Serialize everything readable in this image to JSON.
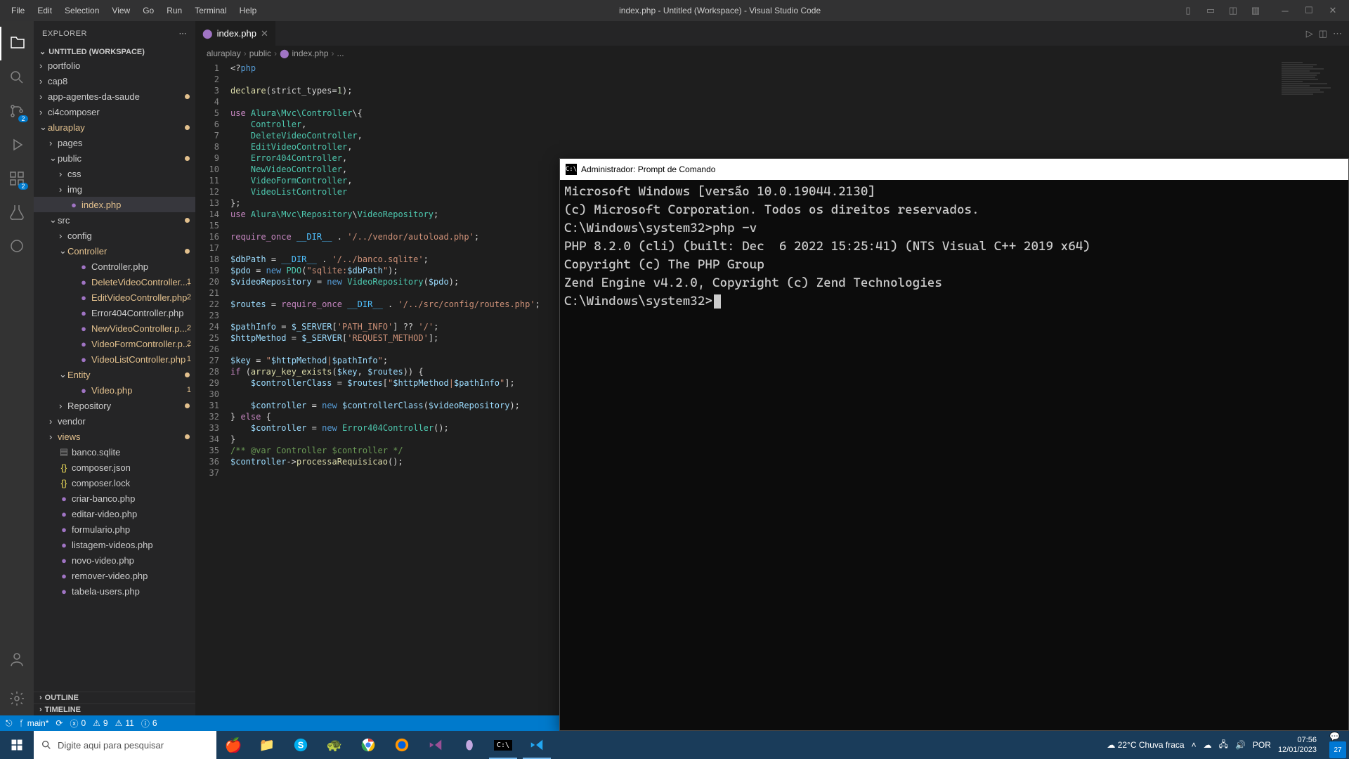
{
  "titlebar": {
    "menus": [
      "File",
      "Edit",
      "Selection",
      "View",
      "Go",
      "Run",
      "Terminal",
      "Help"
    ],
    "title": "index.php - Untitled (Workspace) - Visual Studio Code"
  },
  "activitybar": {
    "scm_badge": "2",
    "ext_badge": "2"
  },
  "sidebar": {
    "header": "EXPLORER",
    "workspace": "UNTITLED (WORKSPACE)",
    "outline": "OUTLINE",
    "timeline": "TIMELINE",
    "tree": [
      {
        "depth": 0,
        "type": "folder",
        "open": false,
        "label": "portfolio"
      },
      {
        "depth": 0,
        "type": "folder",
        "open": false,
        "label": "cap8"
      },
      {
        "depth": 0,
        "type": "folder",
        "open": false,
        "label": "app-agentes-da-saude",
        "dot": true
      },
      {
        "depth": 0,
        "type": "folder",
        "open": false,
        "label": "ci4composer"
      },
      {
        "depth": 0,
        "type": "folder",
        "open": true,
        "label": "aluraplay",
        "mod": true,
        "dot": true
      },
      {
        "depth": 1,
        "type": "folder",
        "open": false,
        "label": "pages"
      },
      {
        "depth": 1,
        "type": "folder",
        "open": true,
        "label": "public",
        "dot": true
      },
      {
        "depth": 2,
        "type": "folder",
        "open": false,
        "label": "css"
      },
      {
        "depth": 2,
        "type": "folder",
        "open": false,
        "label": "img"
      },
      {
        "depth": 2,
        "type": "file",
        "icon": "php",
        "label": "index.php",
        "selected": true,
        "mod": true
      },
      {
        "depth": 1,
        "type": "folder",
        "open": true,
        "label": "src",
        "dot": true
      },
      {
        "depth": 2,
        "type": "folder",
        "open": false,
        "label": "config"
      },
      {
        "depth": 2,
        "type": "folder",
        "open": true,
        "label": "Controller",
        "mod": true,
        "dot": true
      },
      {
        "depth": 3,
        "type": "file",
        "icon": "php",
        "label": "Controller.php"
      },
      {
        "depth": 3,
        "type": "file",
        "icon": "php",
        "label": "DeleteVideoController....",
        "mod": true,
        "badge": "1"
      },
      {
        "depth": 3,
        "type": "file",
        "icon": "php",
        "label": "EditVideoController.php",
        "mod": true,
        "badge": "2"
      },
      {
        "depth": 3,
        "type": "file",
        "icon": "php",
        "label": "Error404Controller.php"
      },
      {
        "depth": 3,
        "type": "file",
        "icon": "php",
        "label": "NewVideoController.p...",
        "mod": true,
        "badge": "2"
      },
      {
        "depth": 3,
        "type": "file",
        "icon": "php",
        "label": "VideoFormController.p...",
        "mod": true,
        "badge": "2"
      },
      {
        "depth": 3,
        "type": "file",
        "icon": "php",
        "label": "VideoListController.php",
        "mod": true,
        "badge": "1"
      },
      {
        "depth": 2,
        "type": "folder",
        "open": true,
        "label": "Entity",
        "mod": true,
        "dot": true
      },
      {
        "depth": 3,
        "type": "file",
        "icon": "php",
        "label": "Video.php",
        "mod": true,
        "badge": "1"
      },
      {
        "depth": 2,
        "type": "folder",
        "open": false,
        "label": "Repository",
        "dot": true
      },
      {
        "depth": 1,
        "type": "folder",
        "open": false,
        "label": "vendor"
      },
      {
        "depth": 1,
        "type": "folder",
        "open": false,
        "label": "views",
        "mod": true,
        "dot": true
      },
      {
        "depth": 1,
        "type": "file",
        "icon": "db",
        "label": "banco.sqlite"
      },
      {
        "depth": 1,
        "type": "file",
        "icon": "json",
        "label": "composer.json"
      },
      {
        "depth": 1,
        "type": "file",
        "icon": "json",
        "label": "composer.lock"
      },
      {
        "depth": 1,
        "type": "file",
        "icon": "php",
        "label": "criar-banco.php"
      },
      {
        "depth": 1,
        "type": "file",
        "icon": "php",
        "label": "editar-video.php"
      },
      {
        "depth": 1,
        "type": "file",
        "icon": "php",
        "label": "formulario.php"
      },
      {
        "depth": 1,
        "type": "file",
        "icon": "php",
        "label": "listagem-videos.php"
      },
      {
        "depth": 1,
        "type": "file",
        "icon": "php",
        "label": "novo-video.php"
      },
      {
        "depth": 1,
        "type": "file",
        "icon": "php",
        "label": "remover-video.php"
      },
      {
        "depth": 1,
        "type": "file",
        "icon": "php",
        "label": "tabela-users.php"
      }
    ]
  },
  "editor": {
    "tab": "index.php",
    "breadcrumb": [
      "aluraplay",
      "public",
      "index.php",
      "..."
    ],
    "lines": 37
  },
  "cmd": {
    "title": "Administrador: Prompt de Comando",
    "lines": [
      "Microsoft Windows [versão 10.0.19044.2130]",
      "(c) Microsoft Corporation. Todos os direitos reservados.",
      "",
      "C:\\Windows\\system32>php -v",
      "PHP 8.2.0 (cli) (built: Dec  6 2022 15:25:41) (NTS Visual C++ 2019 x64)",
      "Copyright (c) The PHP Group",
      "Zend Engine v4.2.0, Copyright (c) Zend Technologies",
      "",
      "C:\\Windows\\system32>"
    ]
  },
  "statusbar": {
    "branch": "main*",
    "sync": "",
    "errors": "0",
    "warnings": "9",
    "warn2": "11",
    "info": "6"
  },
  "taskbar": {
    "search_placeholder": "Digite aqui para pesquisar",
    "weather": "22°C  Chuva fraca",
    "time": "07:56",
    "date": "12/01/2023",
    "notif": "27"
  }
}
